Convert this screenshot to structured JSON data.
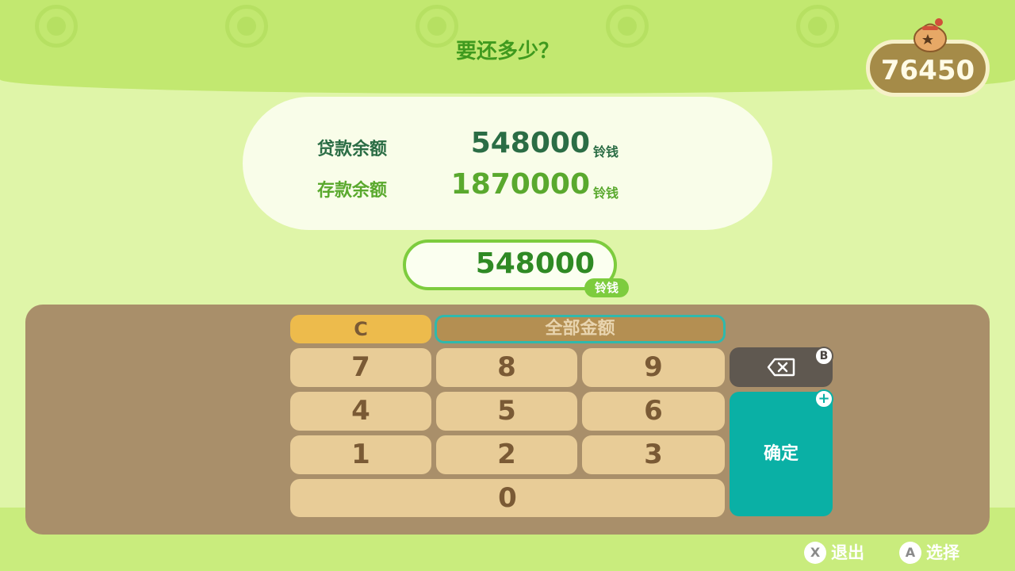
{
  "prompt": "要还多少？",
  "wallet": {
    "bells": "76450",
    "icon": "bell-bag-icon"
  },
  "balances": {
    "loan_label": "贷款余额",
    "loan_value": "548000",
    "savings_label": "存款余额",
    "savings_value": "1870000",
    "unit": "铃钱"
  },
  "input": {
    "value": "548000",
    "unit": "铃钱"
  },
  "keypad": {
    "clear": "C",
    "all_amount": "全部金额",
    "keys": {
      "k7": "7",
      "k8": "8",
      "k9": "9",
      "k4": "4",
      "k5": "5",
      "k6": "6",
      "k1": "1",
      "k2": "2",
      "k3": "3",
      "k0": "0"
    },
    "backspace_icon": "backspace-icon",
    "backspace_badge": "B",
    "confirm": "确定",
    "confirm_badge": "+"
  },
  "hints": {
    "exit_button": "X",
    "exit_label": "退出",
    "select_button": "A",
    "select_label": "选择"
  },
  "colors": {
    "accent_green": "#3f9a1e",
    "keypad_bg": "#a98f6a",
    "confirm_teal": "#0ab0a5"
  }
}
